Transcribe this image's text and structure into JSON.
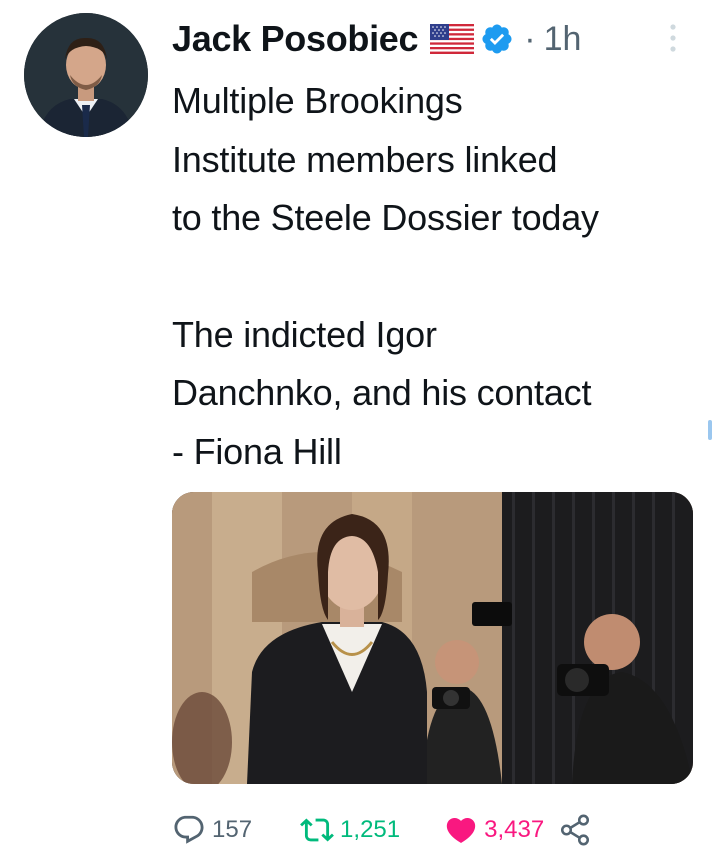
{
  "author": {
    "name": "Jack Posobiec",
    "time": "1h",
    "separator": "·"
  },
  "tweet": {
    "lines_1": [
      "Multiple Brookings",
      "Institute members linked",
      "to the Steele Dossier today"
    ],
    "lines_2": [
      "The indicted Igor",
      "Danchnko, and his contact",
      "- Fiona Hill"
    ]
  },
  "actions": {
    "replies": "157",
    "retweets": "1,251",
    "likes": "3,437"
  },
  "colors": {
    "verified": "#1d9bf0",
    "retweet": "#00ba7c",
    "like": "#f91880",
    "muted": "#536471"
  },
  "icons": {
    "flag": "us-flag-icon",
    "verified": "verified-badge-icon",
    "more": "more-vertical-icon",
    "reply": "reply-icon",
    "retweet": "retweet-icon",
    "like": "heart-icon",
    "share": "share-icon"
  }
}
